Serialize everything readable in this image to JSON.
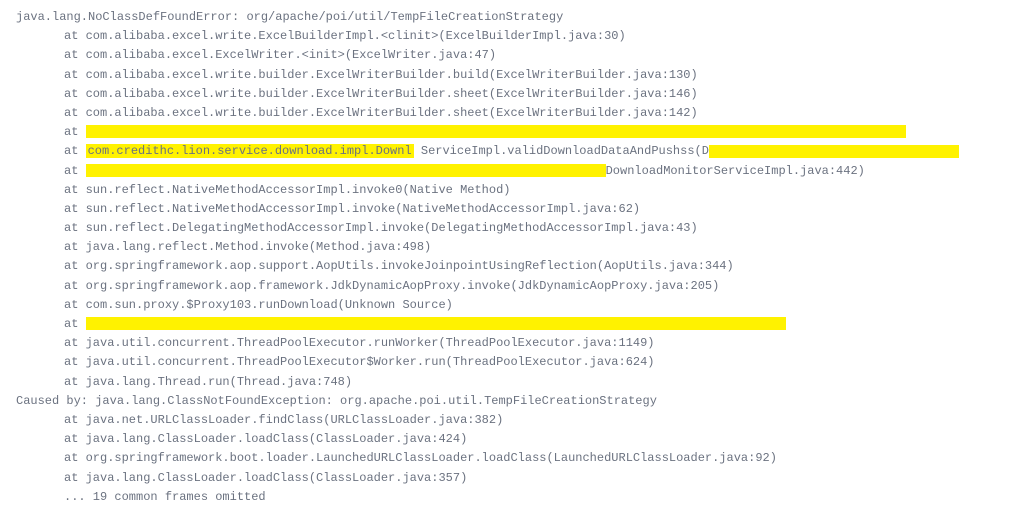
{
  "lines": [
    {
      "indent": 0,
      "text": "java.lang.NoClassDefFoundError: org/apache/poi/util/TempFileCreationStrategy",
      "type": "plain"
    },
    {
      "indent": 1,
      "text": "at com.alibaba.excel.write.ExcelBuilderImpl.<clinit>(ExcelBuilderImpl.java:30)",
      "type": "plain"
    },
    {
      "indent": 1,
      "text": "at com.alibaba.excel.ExcelWriter.<init>(ExcelWriter.java:47)",
      "type": "plain"
    },
    {
      "indent": 1,
      "text": "at com.alibaba.excel.write.builder.ExcelWriterBuilder.build(ExcelWriterBuilder.java:130)",
      "type": "plain"
    },
    {
      "indent": 1,
      "text": "at com.alibaba.excel.write.builder.ExcelWriterBuilder.sheet(ExcelWriterBuilder.java:146)",
      "type": "plain"
    },
    {
      "indent": 1,
      "text": "at com.alibaba.excel.write.builder.ExcelWriterBuilder.sheet(ExcelWriterBuilder.java:142)",
      "type": "plain"
    },
    {
      "indent": 1,
      "text": "at ",
      "type": "redacted-full"
    },
    {
      "indent": 1,
      "text": "at ",
      "type": "redacted-mixed",
      "parts": [
        "com.credithc.lion.service.download.impl.Downl",
        "ServiceImpl.validDownloadDataAndPushss(D"
      ]
    },
    {
      "indent": 1,
      "text": "at ",
      "type": "redacted-with-tail",
      "tail": "DownloadMonitorServiceImpl.java:442)"
    },
    {
      "indent": 1,
      "text": "at sun.reflect.NativeMethodAccessorImpl.invoke0(Native Method)",
      "type": "plain"
    },
    {
      "indent": 1,
      "text": "at sun.reflect.NativeMethodAccessorImpl.invoke(NativeMethodAccessorImpl.java:62)",
      "type": "plain"
    },
    {
      "indent": 1,
      "text": "at sun.reflect.DelegatingMethodAccessorImpl.invoke(DelegatingMethodAccessorImpl.java:43)",
      "type": "plain"
    },
    {
      "indent": 1,
      "text": "at java.lang.reflect.Method.invoke(Method.java:498)",
      "type": "plain"
    },
    {
      "indent": 1,
      "text": "at org.springframework.aop.support.AopUtils.invokeJoinpointUsingReflection(AopUtils.java:344)",
      "type": "plain"
    },
    {
      "indent": 1,
      "text": "at org.springframework.aop.framework.JdkDynamicAopProxy.invoke(JdkDynamicAopProxy.java:205)",
      "type": "plain"
    },
    {
      "indent": 1,
      "text": "at com.sun.proxy.$Proxy103.runDownload(Unknown Source)",
      "type": "plain"
    },
    {
      "indent": 1,
      "text": "at ",
      "type": "redacted-full-2"
    },
    {
      "indent": 1,
      "text": "at java.util.concurrent.ThreadPoolExecutor.runWorker(ThreadPoolExecutor.java:1149)",
      "type": "plain"
    },
    {
      "indent": 1,
      "text": "at java.util.concurrent.ThreadPoolExecutor$Worker.run(ThreadPoolExecutor.java:624)",
      "type": "plain"
    },
    {
      "indent": 1,
      "text": "at java.lang.Thread.run(Thread.java:748)",
      "type": "plain"
    },
    {
      "indent": 0,
      "text": "Caused by: java.lang.ClassNotFoundException: org.apache.poi.util.TempFileCreationStrategy",
      "type": "plain"
    },
    {
      "indent": 1,
      "text": "at java.net.URLClassLoader.findClass(URLClassLoader.java:382)",
      "type": "plain"
    },
    {
      "indent": 1,
      "text": "at java.lang.ClassLoader.loadClass(ClassLoader.java:424)",
      "type": "plain"
    },
    {
      "indent": 1,
      "text": "at org.springframework.boot.loader.LaunchedURLClassLoader.loadClass(LaunchedURLClassLoader.java:92)",
      "type": "plain"
    },
    {
      "indent": 1,
      "text": "at java.lang.ClassLoader.loadClass(ClassLoader.java:357)",
      "type": "plain"
    },
    {
      "indent": 1,
      "text": "... 19 common frames omitted",
      "type": "plain"
    }
  ]
}
